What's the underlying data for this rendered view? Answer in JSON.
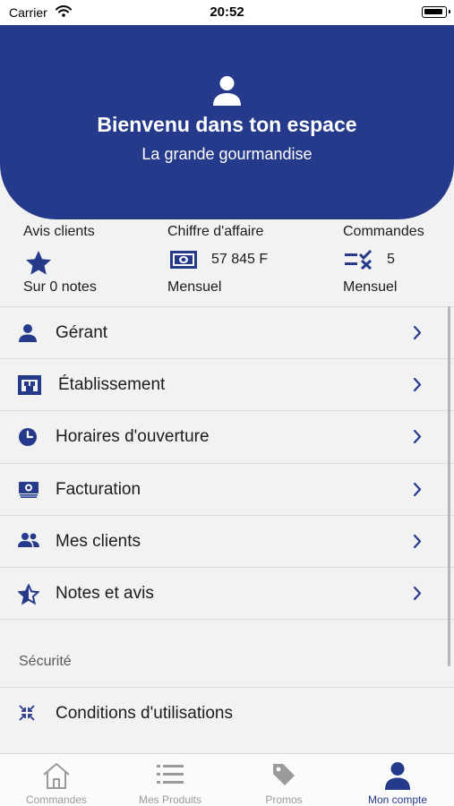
{
  "status_bar": {
    "carrier": "Carrier",
    "time": "20:52"
  },
  "header": {
    "welcome": "Bienvenu dans ton espace",
    "shop_name": "La grande gourmandise"
  },
  "stats": {
    "reviews": {
      "title": "Avis clients",
      "subtitle": "Sur 0 notes",
      "icon": "star-icon"
    },
    "revenue": {
      "title": "Chiffre d'affaire",
      "value": "57 845 F",
      "subtitle": "Mensuel",
      "icon": "banknote-icon"
    },
    "orders": {
      "title": "Commandes",
      "value": "5",
      "subtitle": "Mensuel",
      "icon": "checklist-icon"
    }
  },
  "menu": {
    "items": [
      {
        "label": "Gérant",
        "icon": "person-icon"
      },
      {
        "label": "Établissement",
        "icon": "storefront-icon"
      },
      {
        "label": "Horaires d'ouverture",
        "icon": "clock-icon"
      },
      {
        "label": "Facturation",
        "icon": "money-icon"
      },
      {
        "label": "Mes clients",
        "icon": "people-icon"
      },
      {
        "label": "Notes et avis",
        "icon": "star-half-icon"
      }
    ],
    "security_section": "Sécurité",
    "security_items": [
      {
        "label": "Conditions d'utilisations",
        "icon": "compress-icon"
      }
    ]
  },
  "tabbar": {
    "items": [
      {
        "label": "Commandes",
        "icon": "home-icon"
      },
      {
        "label": "Mes Produits",
        "icon": "list-icon"
      },
      {
        "label": "Promos",
        "icon": "tag-icon"
      },
      {
        "label": "Mon compte",
        "icon": "account-icon"
      }
    ],
    "active": "Mon compte"
  },
  "colors": {
    "primary": "#263a8c",
    "background": "#f2f2f2",
    "inactive": "#9a9a9a"
  }
}
